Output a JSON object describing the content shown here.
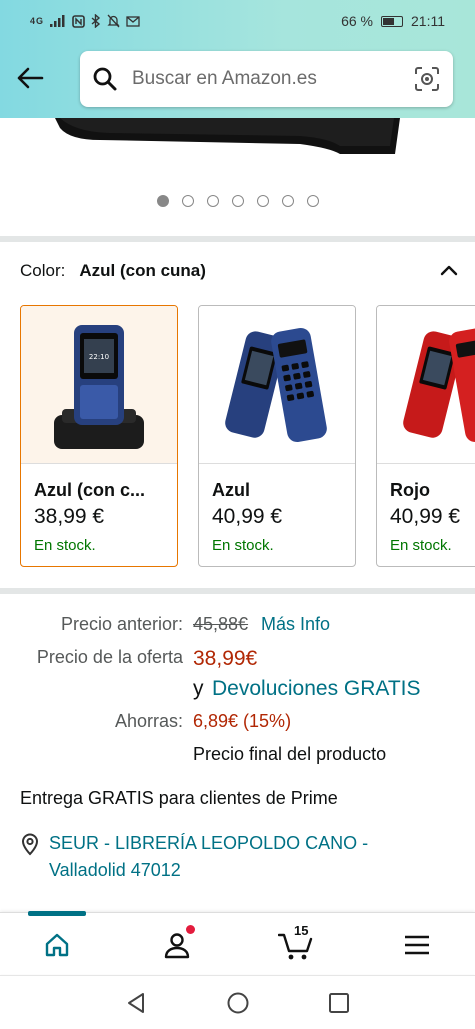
{
  "status_bar": {
    "network": "4G",
    "battery": "66 %",
    "battery_level": 0.66,
    "time": "21:11"
  },
  "header": {
    "search_placeholder": "Buscar en Amazon.es"
  },
  "carousel": {
    "total_dots": 7,
    "active_index": 0
  },
  "variation": {
    "label": "Color:",
    "selected": "Azul (con cuna)",
    "options": [
      {
        "name": "Azul (con c...",
        "price": "38,99 €",
        "stock": "En stock.",
        "selected": true
      },
      {
        "name": "Azul",
        "price": "40,99 €",
        "stock": "En stock.",
        "selected": false
      },
      {
        "name": "Rojo",
        "price": "40,99 €",
        "stock": "En stock.",
        "selected": false
      }
    ]
  },
  "pricing": {
    "list_price_label": "Precio anterior:",
    "list_price": "45,88€",
    "more_info": "Más Info",
    "deal_label": "Precio de la oferta",
    "deal_price": "38,99€",
    "returns_prefix": "y",
    "returns_link": "Devoluciones GRATIS",
    "savings_label": "Ahorras:",
    "savings_value": "6,89€ (15%)",
    "final_note": "Precio final del producto"
  },
  "delivery": {
    "text": "Entrega GRATIS para clientes de Prime",
    "address_line1": "SEUR - LIBRERÍA LEOPOLDO CANO -",
    "address_line2": "Valladolid 47012"
  },
  "bottom_nav": {
    "cart_count": "15",
    "active": "home"
  },
  "colors": {
    "accent_teal": "#007185",
    "price_red": "#b12704",
    "stock_green": "#007600",
    "selected_border": "#e77600",
    "header_gradient_start": "#83d9e1",
    "header_gradient_end": "#a8e6d9"
  }
}
